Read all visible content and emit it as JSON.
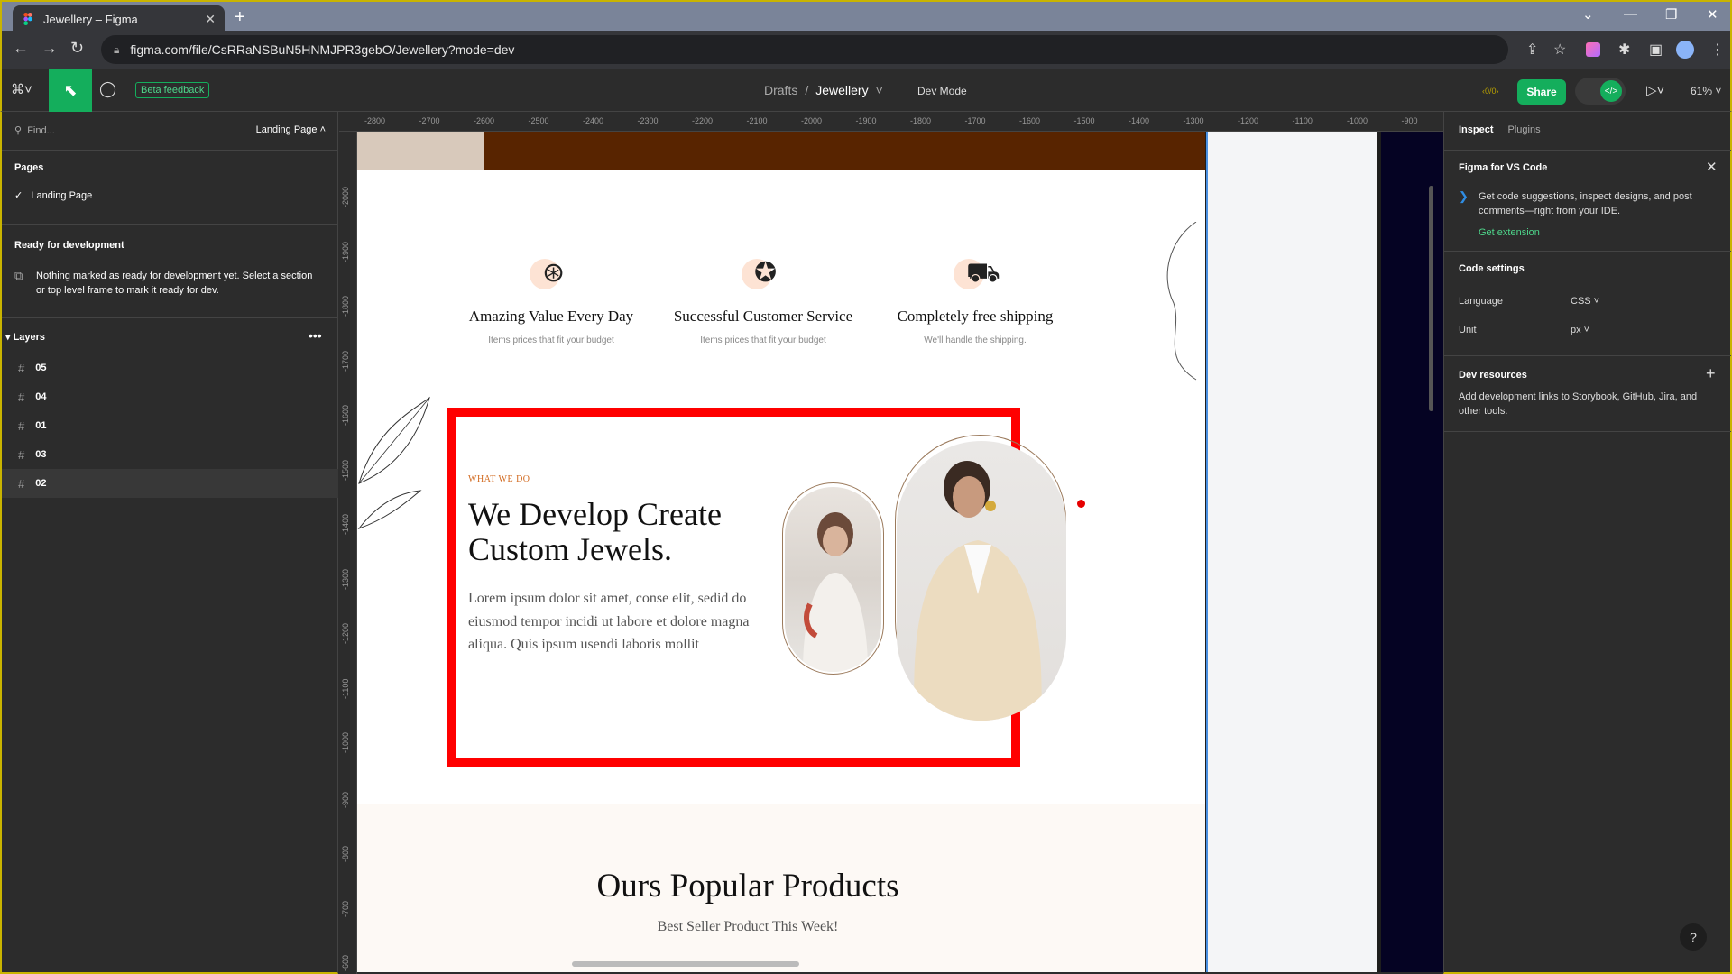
{
  "browser": {
    "tab_title": "Jewellery – Figma",
    "url": "figma.com/file/CsRRaNSBuN5HNMJPR3gebO/Jewellery?mode=dev",
    "new_tab": "+"
  },
  "toolbar": {
    "beta_feedback": "Beta feedback",
    "breadcrumb_root": "Drafts",
    "breadcrumb_sep": "/",
    "file_name": "Jewellery",
    "dev_mode": "Dev Mode",
    "multiplayer": "‹0/0›",
    "share": "Share",
    "zoom": "61%"
  },
  "left_panel": {
    "find_placeholder": "Find...",
    "current_page": "Landing Page",
    "pages_heading": "Pages",
    "pages": [
      "Landing Page"
    ],
    "ready_heading": "Ready for development",
    "ready_text": "Nothing marked as ready for development yet. Select a section or top level frame to mark it ready for dev.",
    "layers_heading": "Layers",
    "layers": [
      "05",
      "04",
      "01",
      "03",
      "02"
    ]
  },
  "ruler": {
    "top_ticks": [
      "-2800",
      "-2700",
      "-2600",
      "-2500",
      "-2400",
      "-2300",
      "-2200",
      "-2100",
      "-2000",
      "-1900",
      "-1800",
      "-1700",
      "-1600",
      "-1500",
      "-1400",
      "-1300",
      "-1200",
      "-1100",
      "-1000",
      "-900"
    ],
    "left_ticks": [
      "-2000",
      "-1900",
      "-1800",
      "-1700",
      "-1600",
      "-1500",
      "-1400",
      "-1300",
      "-1200",
      "-1100",
      "-1000",
      "-900",
      "-800",
      "-700",
      "-600"
    ]
  },
  "design": {
    "features": [
      {
        "title": "Amazing Value Every Day",
        "subtitle": "Items prices that fit your budget",
        "icon": "price-tag-icon"
      },
      {
        "title": "Successful Customer Service",
        "subtitle": "Items prices that fit your budget",
        "icon": "award-badge-icon"
      },
      {
        "title": "Completely free shipping",
        "subtitle": "We'll handle the shipping.",
        "icon": "delivery-truck-icon"
      }
    ],
    "eyebrow": "WHAT WE DO",
    "headline": "We Develop Create Custom Jewels.",
    "paragraph": "Lorem ipsum dolor sit amet, conse elit, sedid do eiusmod tempor incidi ut labore et dolore magna aliqua. Quis ipsum usendi laboris mollit",
    "products_title": "Ours Popular Products",
    "products_subtitle": "Best Seller Product This Week!",
    "highlight_color": "#ff0000",
    "accent_color": "#d2691e"
  },
  "right_panel": {
    "tab_inspect": "Inspect",
    "tab_plugins": "Plugins",
    "vscode_heading": "Figma for VS Code",
    "vscode_text": "Get code suggestions, inspect designs, and post comments—right from your IDE.",
    "vscode_link": "Get extension",
    "code_settings_heading": "Code settings",
    "language_label": "Language",
    "language_value": "CSS",
    "unit_label": "Unit",
    "unit_value": "px",
    "dev_resources_heading": "Dev resources",
    "dev_resources_text": "Add development links to Storybook, GitHub, Jira, and other tools.",
    "help": "?"
  },
  "colors": {
    "figma_green": "#14ae5c",
    "panel_bg": "#2c2c2c"
  }
}
